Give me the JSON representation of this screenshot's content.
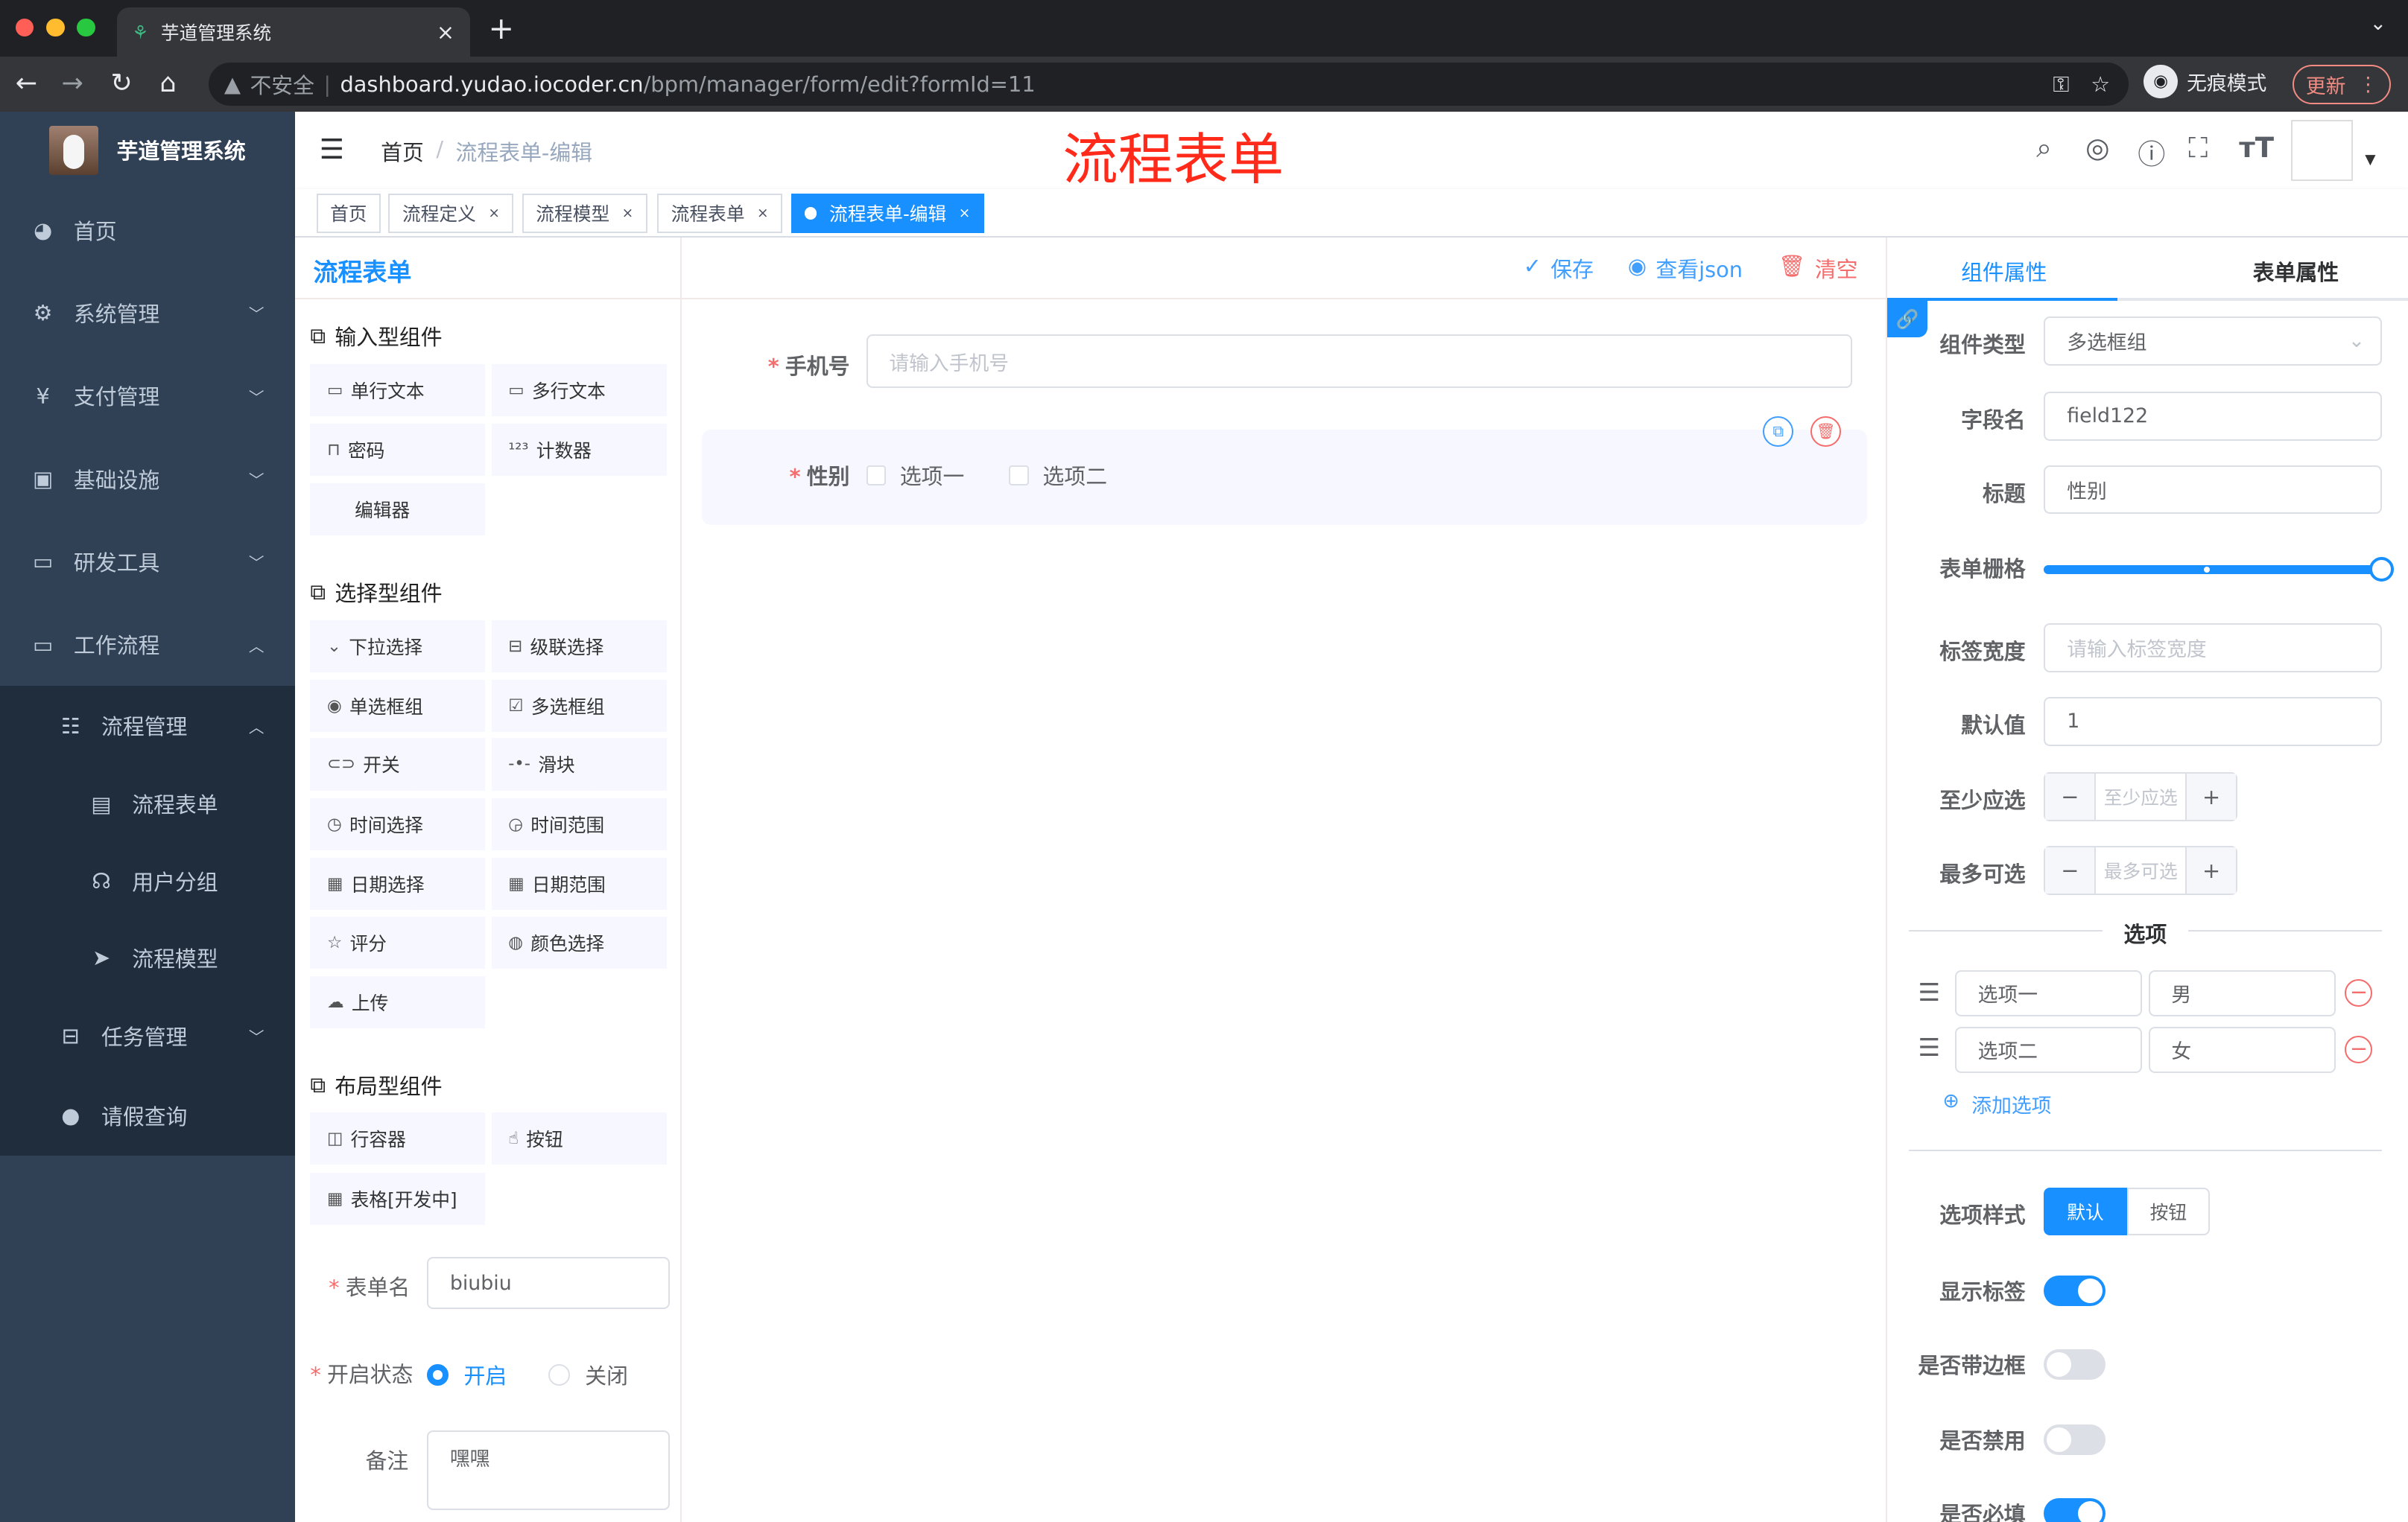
{
  "browser": {
    "tab_title": "芋道管理系统",
    "tab_close": "×",
    "new_tab": "+",
    "insecure": "不安全",
    "url_host": "dashboard.yudao.iocoder.cn",
    "url_path": "/bpm/manager/form/edit?formId=11",
    "incognito": "无痕模式",
    "update": "更新"
  },
  "sidebar": {
    "logo": "芋道管理系统",
    "items": [
      {
        "label": "首页",
        "icon": "dashboard-icon"
      },
      {
        "label": "系统管理",
        "icon": "gear-icon"
      },
      {
        "label": "支付管理",
        "icon": "yen-icon"
      },
      {
        "label": "基础设施",
        "icon": "monitor-icon"
      },
      {
        "label": "研发工具",
        "icon": "toolbox-icon"
      },
      {
        "label": "工作流程",
        "icon": "toolbox-icon"
      }
    ],
    "sub": {
      "label": "流程管理",
      "items": [
        "流程表单",
        "用户分组",
        "流程模型"
      ]
    },
    "more": [
      "任务管理",
      "请假查询"
    ]
  },
  "navbar": {
    "breadcrumb_home": "首页",
    "breadcrumb_sep": "/",
    "breadcrumb_current": "流程表单-编辑",
    "page_title": "流程表单"
  },
  "tags": [
    "首页",
    "流程定义",
    "流程模型",
    "流程表单",
    "流程表单-编辑"
  ],
  "left": {
    "title": "流程表单",
    "sections": [
      "输入型组件",
      "选择型组件",
      "布局型组件"
    ],
    "input": [
      "单行文本",
      "多行文本",
      "密码",
      "计数器",
      "编辑器"
    ],
    "select": [
      "下拉选择",
      "级联选择",
      "单选框组",
      "多选框组",
      "开关",
      "滑块",
      "时间选择",
      "时间范围",
      "日期选择",
      "日期范围",
      "评分",
      "颜色选择",
      "上传"
    ],
    "layout": [
      "行容器",
      "按钮",
      "表格[开发中]"
    ],
    "form_name_label": "表单名",
    "form_name": "biubiu",
    "status_label": "开启状态",
    "status_on": "开启",
    "status_off": "关闭",
    "remark_label": "备注",
    "remark": "嘿嘿"
  },
  "toolbar": {
    "save": "保存",
    "json": "查看json",
    "clear": "清空"
  },
  "canvas": {
    "phone_label": "手机号",
    "phone_placeholder": "请输入手机号",
    "gender_label": "性别",
    "options": [
      "选项一",
      "选项二"
    ]
  },
  "right": {
    "tabs": [
      "组件属性",
      "表单属性"
    ],
    "type_label": "组件类型",
    "type_value": "多选框组",
    "field_label": "字段名",
    "field_value": "field122",
    "title_label": "标题",
    "title_value": "性别",
    "grid_label": "表单栅格",
    "grid_value": 24,
    "labelwidth_label": "标签宽度",
    "labelwidth_placeholder": "请输入标签宽度",
    "default_label": "默认值",
    "default_value": "1",
    "min_label": "至少应选",
    "min_placeholder": "至少应选",
    "max_label": "最多可选",
    "max_placeholder": "最多可选",
    "options_title": "选项",
    "options": [
      {
        "label": "选项一",
        "value": "男"
      },
      {
        "label": "选项二",
        "value": "女"
      }
    ],
    "add_option": "添加选项",
    "style_label": "选项样式",
    "style_default": "默认",
    "style_button": "按钮",
    "show_label": "显示标签",
    "show_label_on": true,
    "border_label": "是否带边框",
    "border_on": false,
    "disabled_label": "是否禁用",
    "disabled_on": false,
    "required_label": "是否必填",
    "required_on": true
  },
  "colors": {
    "primary": "#1890ff",
    "sidebar": "#304156",
    "danger": "#f56c6c",
    "title_red": "#ff2a1a"
  }
}
